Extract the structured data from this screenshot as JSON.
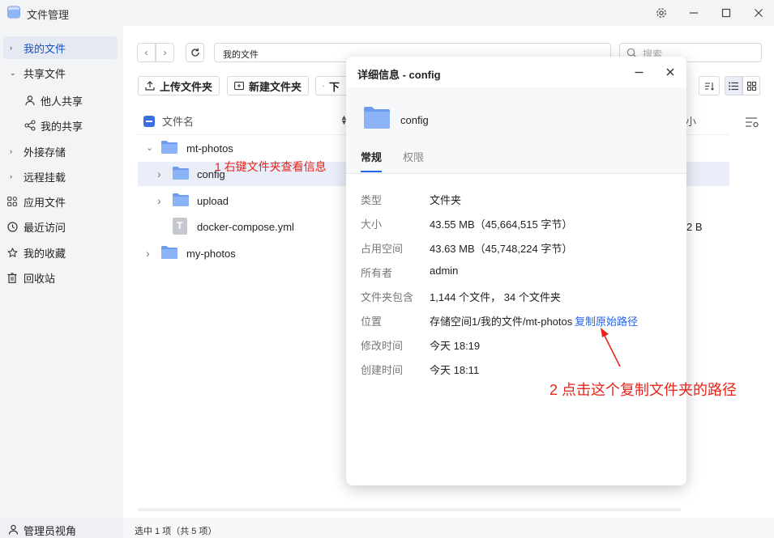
{
  "app": {
    "title": "文件管理"
  },
  "sidebar": {
    "items": [
      {
        "label": "我的文件",
        "arrow": "›",
        "active": true
      },
      {
        "label": "共享文件",
        "arrow": "⌄"
      },
      {
        "label": "他人共享"
      },
      {
        "label": "我的共享"
      },
      {
        "label": "外接存储",
        "arrow": "›"
      },
      {
        "label": "远程挂载",
        "arrow": "›"
      },
      {
        "label": "应用文件"
      },
      {
        "label": "最近访问"
      },
      {
        "label": "我的收藏"
      },
      {
        "label": "回收站"
      }
    ],
    "admin_label": "管理员视角"
  },
  "toolbar": {
    "path": "我的文件",
    "search_placeholder": "搜索",
    "upload_label": "上传文件夹",
    "new_folder_label": "新建文件夹",
    "download_label_partial": "下"
  },
  "file_list": {
    "header_name": "文件名",
    "header_size_partial": "小",
    "rows": [
      {
        "name": "mt-photos",
        "type": "folder",
        "expander": "⌄"
      },
      {
        "name": "config",
        "type": "folder",
        "expander": "›"
      },
      {
        "name": "upload",
        "type": "folder",
        "expander": "›"
      },
      {
        "name": "docker-compose.yml",
        "type": "file",
        "size_partial": "2 B"
      },
      {
        "name": "my-photos",
        "type": "folder",
        "expander": "›"
      }
    ]
  },
  "status": {
    "text": "选中 1 项（共 5 项）"
  },
  "dialog": {
    "title": "详细信息 - config",
    "name": "config",
    "tabs": [
      "常规",
      "权限"
    ],
    "properties": [
      {
        "label": "类型",
        "value": "文件夹"
      },
      {
        "label": "大小",
        "value": "43.55 MB（45,664,515 字节）"
      },
      {
        "label": "占用空间",
        "value": "43.63 MB（45,748,224 字节）"
      },
      {
        "label": "所有者",
        "value": "admin"
      },
      {
        "label": "文件夹包含",
        "value": "1,144 个文件， 34 个文件夹"
      },
      {
        "label": "位置",
        "value": "存储空间1/我的文件/mt-photos",
        "link": "复制原始路径"
      },
      {
        "label": "修改时间",
        "value": "今天 18:19"
      },
      {
        "label": "创建时间",
        "value": "今天 18:11"
      }
    ]
  },
  "annotations": {
    "step1": "1 右键文件夹查看信息",
    "step2": "2 点击这个复制文件夹的路径"
  },
  "colors": {
    "accent": "#2563eb",
    "annotation": "#e6241a",
    "folder": "#6d9bf2"
  }
}
